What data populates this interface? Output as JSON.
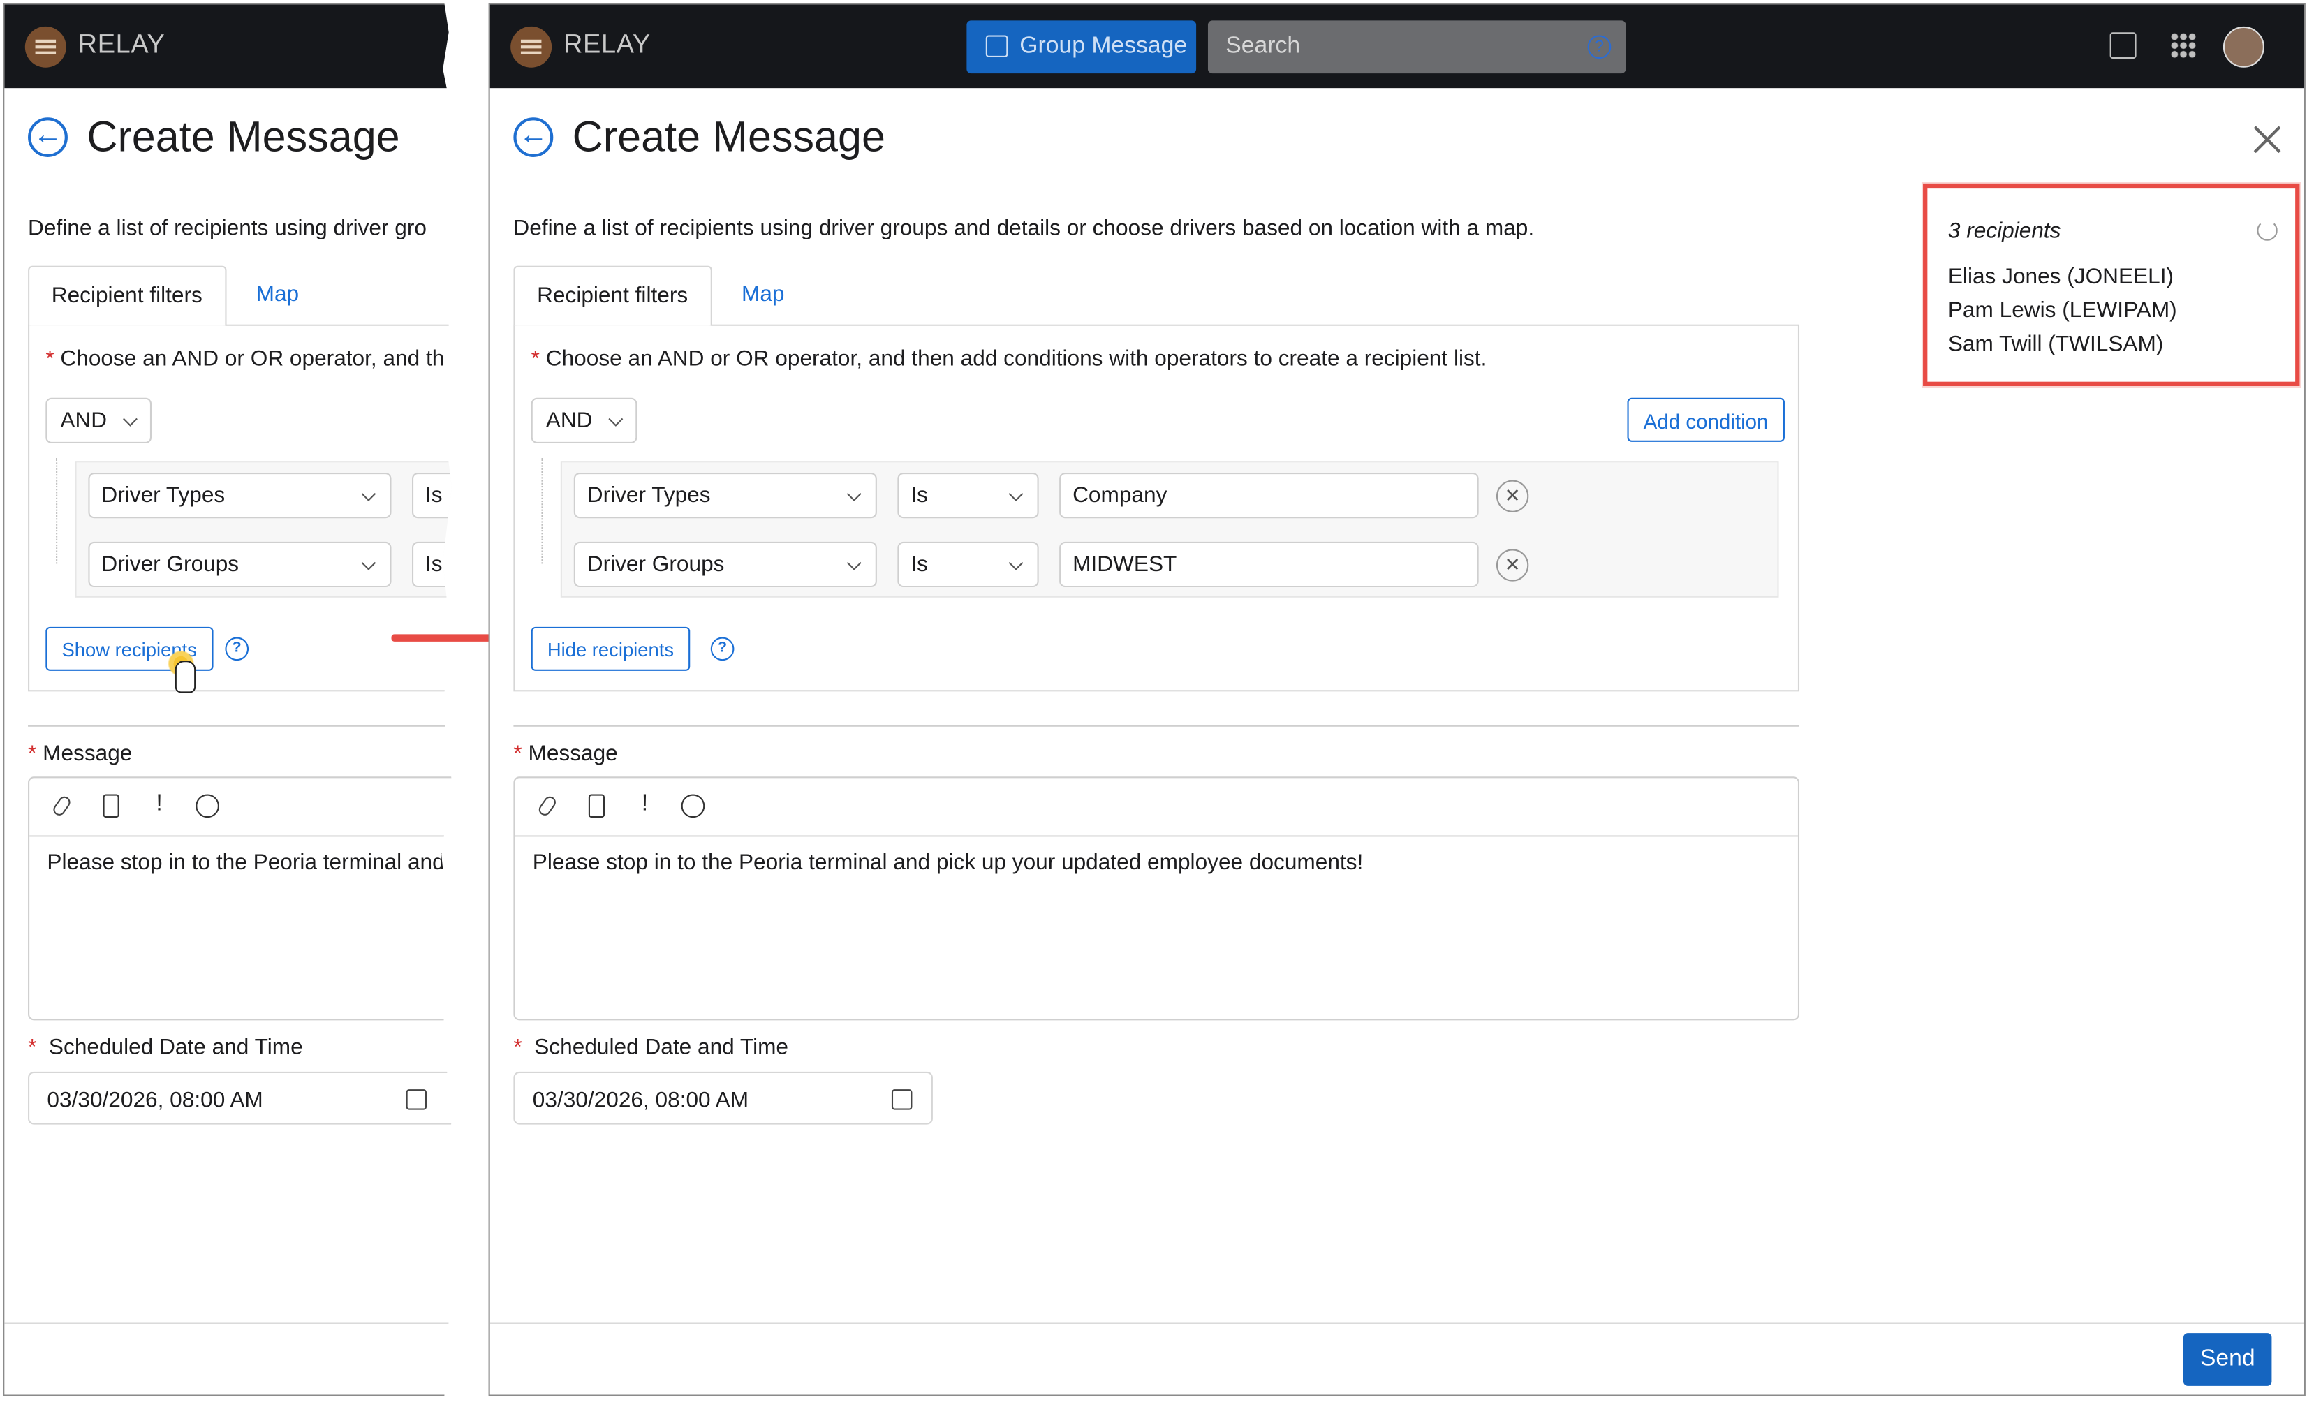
{
  "app": {
    "brand": "RELAY",
    "group_message_label": "Group Message",
    "search_placeholder": "Search"
  },
  "page": {
    "title": "Create Message",
    "description_full": "Define a list of recipients using driver groups and details or choose drivers based on location with a map.",
    "description_cropped": "Define a list of recipients using driver gro"
  },
  "tabs": {
    "recipient_filters": "Recipient filters",
    "map": "Map"
  },
  "filters": {
    "required_mark": "*",
    "instruction_full": "Choose an AND or OR operator, and then add conditions with operators to create a recipient list.",
    "instruction_cropped": "Choose an AND or OR operator, and th",
    "operator": "AND",
    "add_condition_label": "Add condition",
    "conditions": [
      {
        "field": "Driver Types",
        "op": "Is",
        "value": "Company"
      },
      {
        "field": "Driver Groups",
        "op": "Is",
        "value": "MIDWEST"
      }
    ],
    "show_recipients_label": "Show recipients",
    "hide_recipients_label": "Hide recipients",
    "help_glyph": "?"
  },
  "message": {
    "label": "Message",
    "bang_glyph": "!",
    "text_full": "Please stop in to the Peoria terminal and pick up your updated employee documents!",
    "text_cropped": "Please stop in to the Peoria terminal and"
  },
  "schedule": {
    "label": "Scheduled Date and Time",
    "value": "03/30/2026, 08:00  AM"
  },
  "recipients_panel": {
    "count_label": "3 recipients",
    "items": [
      "Elias Jones (JONEELI)",
      "Pam Lewis (LEWIPAM)",
      "Sam Twill (TWILSAM)"
    ]
  },
  "footer": {
    "send_label": "Send"
  },
  "colors": {
    "accent": "#1565c0",
    "link": "#1a6fd6",
    "topbar": "#15171b",
    "highlight": "#e84b45"
  }
}
